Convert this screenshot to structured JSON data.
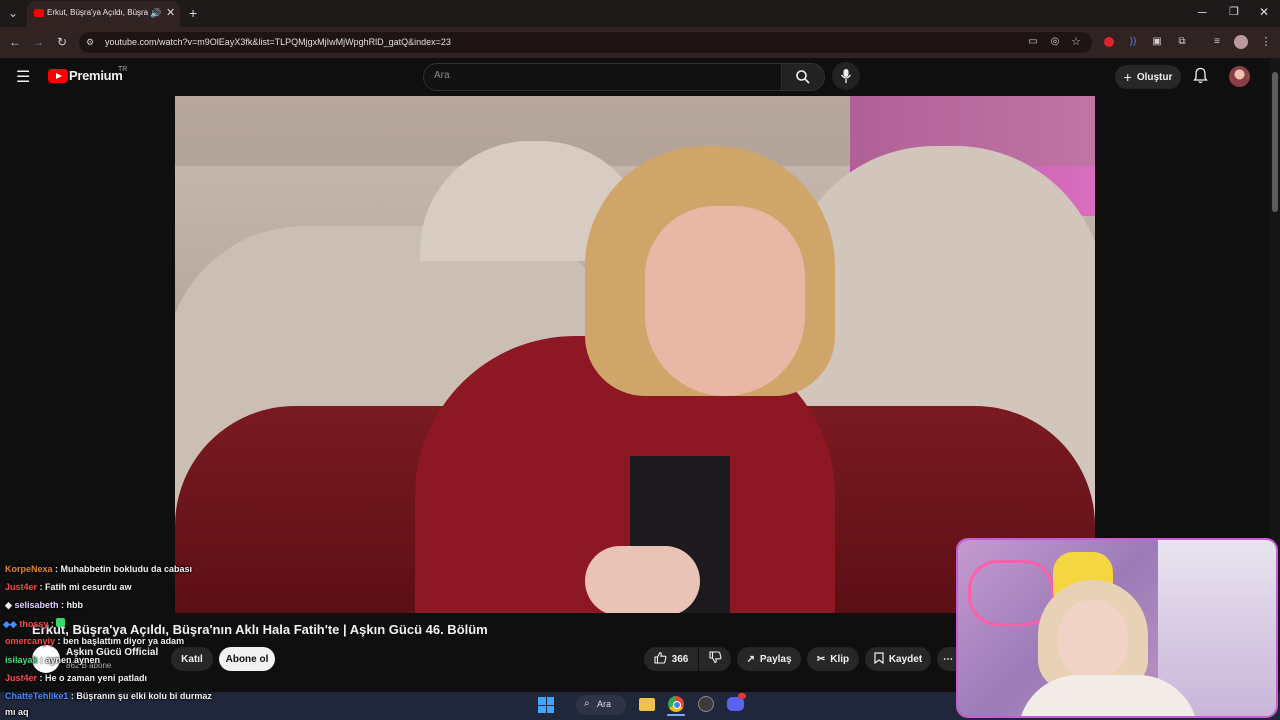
{
  "browser": {
    "tab_title": "Erkut, Büşra'ya Açıldı, Büşra",
    "url": "youtube.com/watch?v=m9OlEayX3fk&list=TLPQMjgxMjIwMjWpghRlD_gatQ&index=23"
  },
  "youtube": {
    "logo_text": "Premium",
    "logo_region": "TR",
    "search_placeholder": "Ara",
    "create_label": "Oluştur"
  },
  "video": {
    "title": "Erkut, Büşra'ya Açıldı, Büşra'nın Aklı Hala Fatih'te | Aşkın Gücü 46. Bölüm",
    "channel_name": "Aşkın Gücü Official",
    "subscribers": "862 B abone",
    "join_label": "Katıl",
    "subscribe_label": "Abone ol",
    "likes": "366",
    "share_label": "Paylaş",
    "clip_label": "Klip",
    "save_label": "Kaydet"
  },
  "chat": [
    {
      "user": "KorpeNexa",
      "message": "Muhabbetin bokludu da cabası",
      "color": "#e8862a"
    },
    {
      "user": "Just4er",
      "message": "Fatih mi cesurdu aw",
      "color": "#ff4a4a"
    },
    {
      "user": "selisabeth",
      "message": "hbb",
      "color": "#e0d0ff"
    },
    {
      "user": "thossy",
      "message": "",
      "color": "#ff4a4a"
    },
    {
      "user": "omercanyiy",
      "message": "ben başlattım diyor ya adam",
      "color": "#ff4a4a"
    },
    {
      "user": "isilayak",
      "message": "aynen aynen",
      "color": "#40e080"
    },
    {
      "user": "Just4er",
      "message": "He o zaman yeni patladı",
      "color": "#ff4a4a"
    },
    {
      "user": "ChatteTehlike1",
      "message": "Büşranın şu elki kolu bi durmaz",
      "color": "#4a8cff"
    },
    {
      "user": "",
      "message": "mı aq",
      "color": "#ffffff"
    }
  ],
  "taskbar": {
    "search_label": "Ara"
  },
  "colors": {
    "youtube_red": "#ff0000",
    "webcam_border": "#c85bd6",
    "taskbar": "#20273a"
  }
}
